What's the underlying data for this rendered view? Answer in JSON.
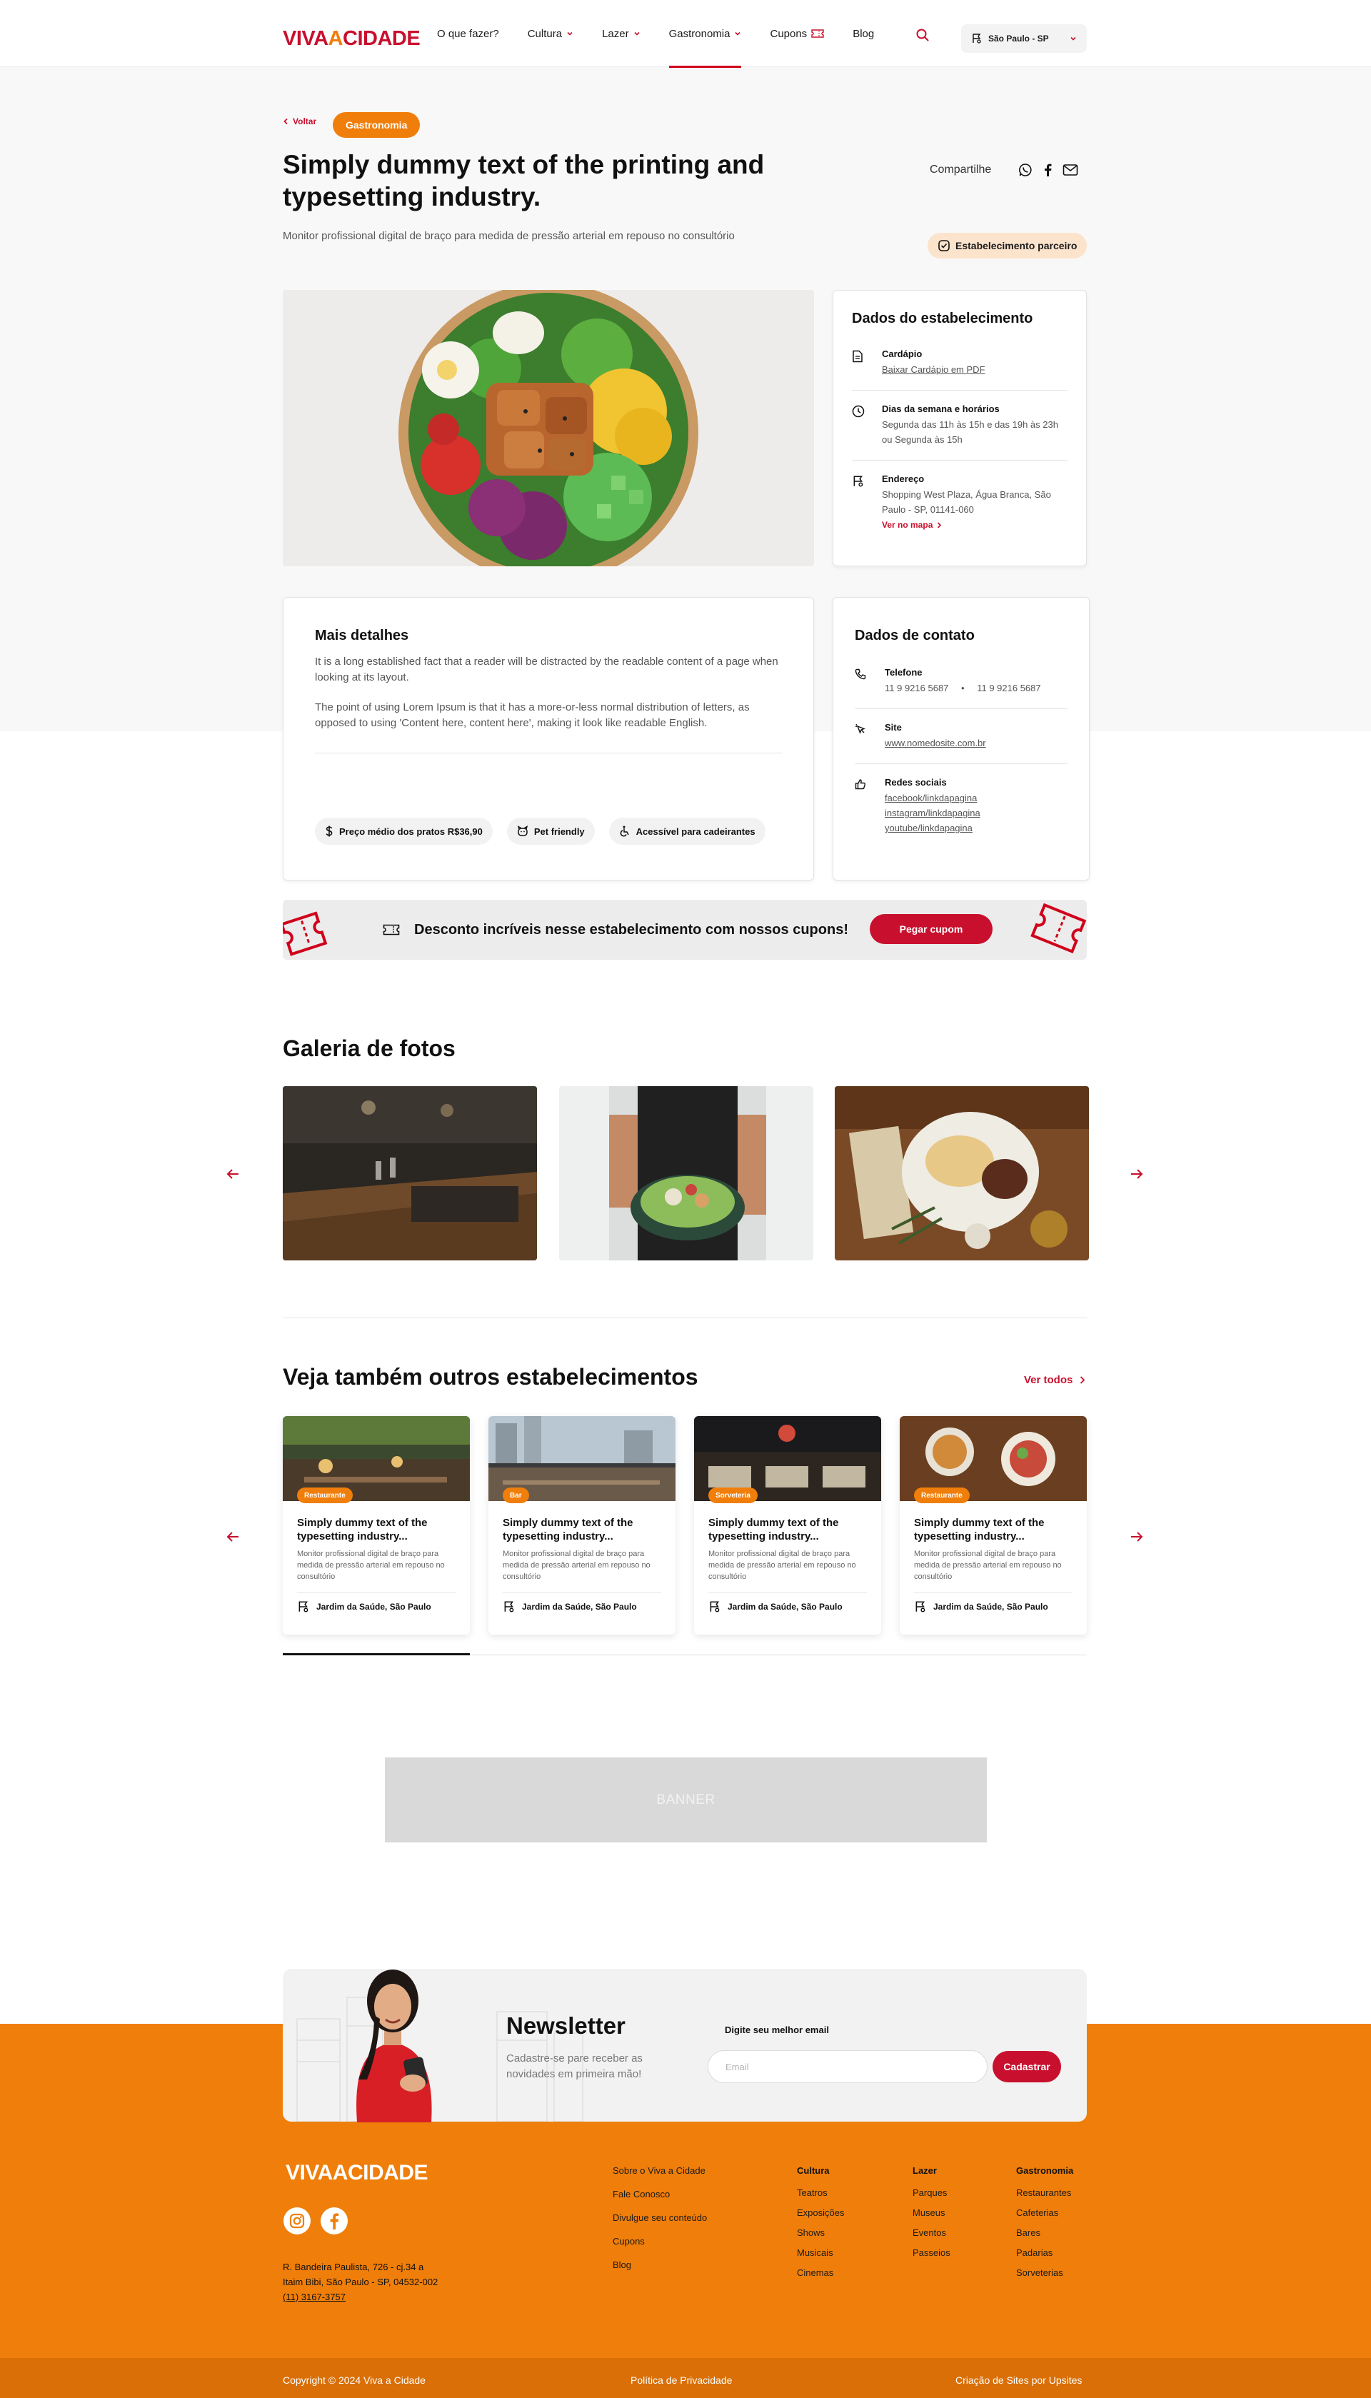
{
  "header": {
    "logo": {
      "part1": "VIVA",
      "amp": "A",
      "part2": "CIDADE"
    },
    "nav": [
      {
        "label": "O que fazer?",
        "has_dropdown": false
      },
      {
        "label": "Cultura",
        "has_dropdown": true
      },
      {
        "label": "Lazer",
        "has_dropdown": true
      },
      {
        "label": "Gastronomia",
        "has_dropdown": true,
        "active": true
      },
      {
        "label": "Cupons",
        "icon": "coupon-icon"
      },
      {
        "label": "Blog",
        "has_dropdown": false
      }
    ],
    "location": "São Paulo - SP"
  },
  "page": {
    "back_label": "Voltar",
    "category": "Gastronomia",
    "title": "Simply dummy text of the printing and typesetting industry.",
    "subtitle": "Monitor profissional digital de braço para medida de pressão arterial em repouso no consultório",
    "share_label": "Compartilhe",
    "partner_badge": "Estabelecimento parceiro"
  },
  "establishment": {
    "title": "Dados do estabelecimento",
    "menu_label": "Cardápio",
    "menu_link": "Baixar Cardápio em PDF",
    "hours_label": "Dias da semana e horários",
    "hours_value": "Segunda das 11h às 15h e das 19h às 23h ou Segunda às 15h",
    "address_label": "Endereço",
    "address_value": "Shopping West Plaza, Água Branca, São Paulo - SP, 01141-060",
    "map_link": "Ver no mapa"
  },
  "details": {
    "title": "Mais detalhes",
    "paragraph1": "It is a long established fact that a reader will be distracted by the readable content of a page when looking at its layout.",
    "paragraph2": "The point of using Lorem Ipsum is that it has a more-or-less normal distribution of letters, as opposed to using 'Content here, content here', making it look like readable English.",
    "tags": [
      {
        "label": "Preço médio dos  pratos  R$36,90",
        "icon": "dollar-icon"
      },
      {
        "label": "Pet friendly",
        "icon": "pet-icon"
      },
      {
        "label": "Acessível para cadeirantes",
        "icon": "wheelchair-icon"
      }
    ]
  },
  "contact": {
    "title": "Dados de contato",
    "phone_label": "Telefone",
    "phone1": "11 9 9216 5687",
    "phone2": "11 9 9216 5687",
    "site_label": "Site",
    "site_value": "www.nomedosite.com.br",
    "social_label": "Redes sociais",
    "social_links": [
      "facebook/linkdapagina",
      "instagram/linkdapagina",
      "youtube/linkdapagina"
    ]
  },
  "coupon_banner": {
    "text": "Desconto incríveis nesse estabelecimento com nossos cupons!",
    "button": "Pegar cupom"
  },
  "gallery": {
    "title": "Galeria de fotos"
  },
  "related": {
    "title": "Veja também outros estabelecimentos",
    "see_all": "Ver todos",
    "items": [
      {
        "category": "Restaurante",
        "title": "Simply dummy text of the typesetting industry...",
        "desc": "Monitor profissional digital de braço para medida de pressão arterial em repouso no consultório",
        "location": "Jardim da Saúde, São Paulo"
      },
      {
        "category": "Bar",
        "title": "Simply dummy text of the typesetting industry...",
        "desc": "Monitor profissional digital de braço para medida de pressão arterial em repouso no consultório",
        "location": "Jardim da Saúde, São Paulo"
      },
      {
        "category": "Sorveteria",
        "title": "Simply dummy text of the typesetting industry...",
        "desc": "Monitor profissional digital de braço para medida de pressão arterial em repouso no consultório",
        "location": "Jardim da Saúde, São Paulo"
      },
      {
        "category": "Restaurante",
        "title": "Simply dummy text of the typesetting industry...",
        "desc": "Monitor profissional digital de braço para medida de pressão arterial em repouso no consultório",
        "location": "Jardim da Saúde, São Paulo"
      }
    ]
  },
  "ad_banner": "BANNER",
  "newsletter": {
    "title": "Newsletter",
    "desc": "Cadastre-se pare receber as novidades em primeira mão!",
    "label": "Digite seu melhor email",
    "placeholder": "Email",
    "button": "Cadastrar"
  },
  "footer": {
    "logo": {
      "part1": "VIVA",
      "amp": "A",
      "part2": "CIDADE"
    },
    "address_line1": "R. Bandeira Paulista, 726 - cj.34 a",
    "address_line2": "Itaim Bibi, São Paulo - SP, 04532-002",
    "phone": "(11) 3167-3757",
    "main_links": [
      "Sobre o Viva a Cidade",
      "Fale Conosco",
      "Divulgue seu conteúdo",
      "Cupons",
      "Blog"
    ],
    "columns": [
      {
        "heading": "Cultura",
        "links": [
          "Teatros",
          "Exposições",
          "Shows",
          "Musicais",
          "Cinemas"
        ]
      },
      {
        "heading": "Lazer",
        "links": [
          "Parques",
          "Museus",
          "Eventos",
          "Passeios"
        ]
      },
      {
        "heading": "Gastronomia",
        "links": [
          "Restaurantes",
          "Cafeterias",
          "Bares",
          "Padarias",
          "Sorveterias"
        ]
      }
    ],
    "copyright": "Copyright © 2024 Viva a Cidade",
    "privacy": "Política de Privacidade",
    "credit": "Criação de Sites por Upsites"
  },
  "colors": {
    "brand_red": "#c8102e",
    "brand_orange": "#f07e0a",
    "footer_bottom": "#d96f06",
    "partner_badge_bg": "#fbe3cc"
  }
}
